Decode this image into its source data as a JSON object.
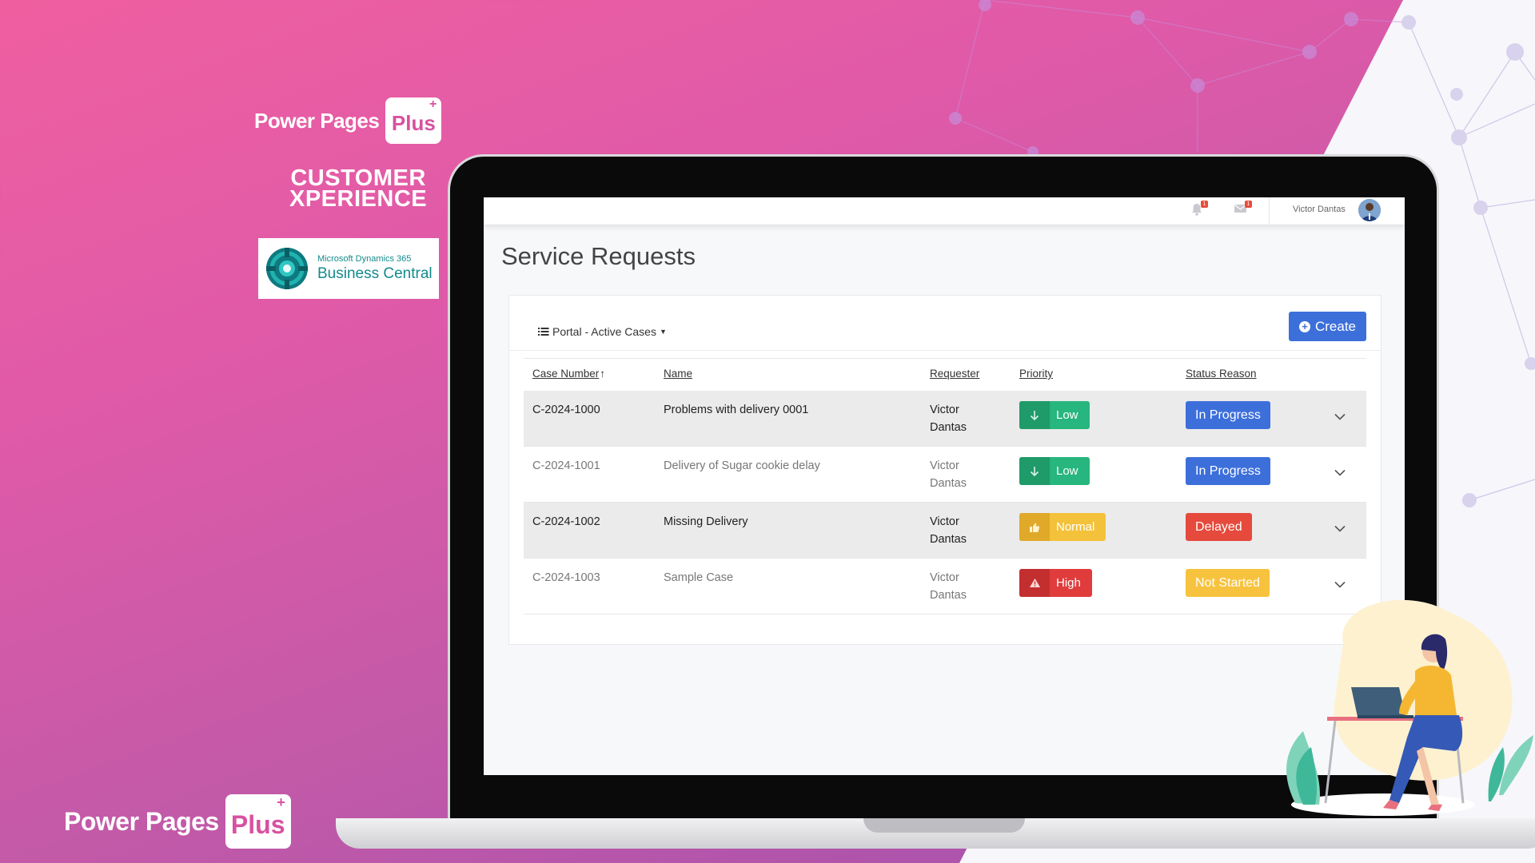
{
  "branding": {
    "power_pages": "Power Pages",
    "plus": "Plus",
    "plus_mark": "+",
    "tagline_line1": "CUSTOMER",
    "tagline_line2": "XPERIENCE",
    "bc_small": "Microsoft Dynamics 365",
    "bc_big": "Business Central"
  },
  "topbar": {
    "notifications_count": "1",
    "messages_count": "1",
    "user_name": "Victor Dantas",
    "icons": [
      "bell-icon",
      "envelope-icon",
      "avatar"
    ]
  },
  "page": {
    "title": "Service Requests",
    "view_label": "Portal - Active Cases",
    "create_label": "Create"
  },
  "table": {
    "columns": [
      "Case Number",
      "Name",
      "Requester",
      "Priority",
      "Status Reason"
    ],
    "sort_indicator": "↑",
    "rows": [
      {
        "case": "C-2024-1000",
        "name": "Problems with delivery 0001",
        "req1": "Victor",
        "req2": "Dantas",
        "priority": "Low",
        "status": "In Progress"
      },
      {
        "case": "C-2024-1001",
        "name": "Delivery of Sugar cookie delay",
        "req1": "Victor",
        "req2": "Dantas",
        "priority": "Low",
        "status": "In Progress"
      },
      {
        "case": "C-2024-1002",
        "name": "Missing Delivery",
        "req1": "Victor",
        "req2": "Dantas",
        "priority": "Normal",
        "status": "Delayed"
      },
      {
        "case": "C-2024-1003",
        "name": "Sample Case",
        "req1": "Victor",
        "req2": "Dantas",
        "priority": "High",
        "status": "Not Started"
      }
    ]
  },
  "colors": {
    "priority_low": "#27b67d",
    "priority_low_icon": "#1f9a69",
    "priority_normal": "#f3c23a",
    "priority_normal_icon": "#e0a92a",
    "priority_high": "#e03c3c",
    "priority_high_icon": "#c32f2f",
    "status_in_progress": "#3d6fdb",
    "status_delayed": "#e54a3c",
    "status_not_started": "#f7c33e",
    "create_button": "#3d6fdb"
  }
}
